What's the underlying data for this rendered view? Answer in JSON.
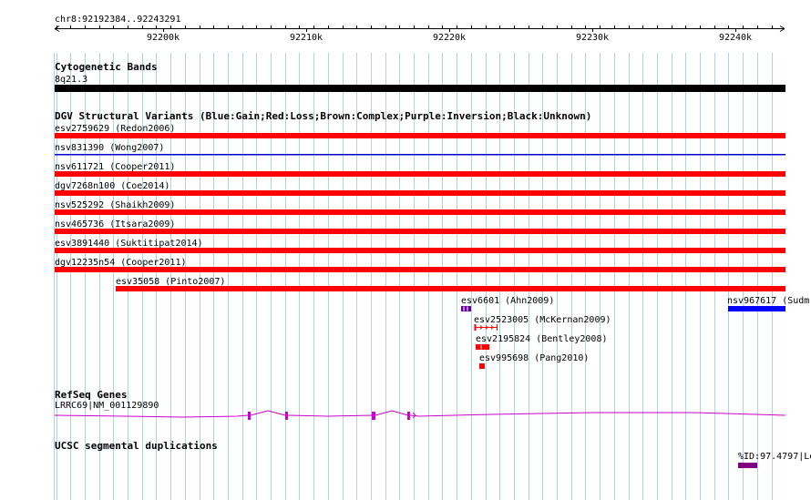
{
  "ruler": {
    "position": "chr8:92192384..92243291",
    "ticks": [
      "92200k",
      "92210k",
      "92220k",
      "92230k",
      "92240k"
    ]
  },
  "cytoband": {
    "title": "Cytogenetic Bands",
    "band": "8q21.3",
    "color": "#000000"
  },
  "dgv": {
    "title": "DGV Structural Variants (Blue:Gain;Red:Loss;Brown:Complex;Purple:Inversion;Black:Unknown)",
    "variants": [
      {
        "label": "esv2759629 (Redon2006)",
        "color": "#ff0000"
      },
      {
        "label": "nsv831390 (Wong2007)",
        "color": "#0000cc"
      },
      {
        "label": "nsv611721 (Cooper2011)",
        "color": "#ff0000"
      },
      {
        "label": "dgv7268n100 (Coe2014)",
        "color": "#ff0000"
      },
      {
        "label": "nsv525292 (Shaikh2009)",
        "color": "#ff0000"
      },
      {
        "label": "nsv465736 (Itsara2009)",
        "color": "#ff0000"
      },
      {
        "label": "esv3891440 (Suktitipat2014)",
        "color": "#ff0000"
      },
      {
        "label": "dgv12235n54 (Cooper2011)",
        "color": "#ff0000"
      },
      {
        "label": "esv35058 (Pinto2007)",
        "color": "#ff0000"
      },
      {
        "label": "esv6601 (Ahn2009)",
        "color": "#660099"
      },
      {
        "label": "nsv967617 (Sudm",
        "color": "#0000ff"
      },
      {
        "label": "esv2523005 (McKernan2009)",
        "color": "#ff0000"
      },
      {
        "label": "esv2195824 (Bentley2008)",
        "color": "#ff0000"
      },
      {
        "label": "esv995698 (Pang2010)",
        "color": "#ff0000"
      }
    ]
  },
  "refseq": {
    "title": "RefSeq Genes",
    "gene": "LRRC69|NM_001129890",
    "color": "#cc00cc"
  },
  "segdups": {
    "title": "UCSC segmental duplications",
    "label": "%ID:97.4797|Le",
    "color": "#800080"
  },
  "colors": {
    "grid": "#aad4ee",
    "loss": "#ff0000",
    "gain": "#0000ff",
    "inversion": "#660099"
  }
}
